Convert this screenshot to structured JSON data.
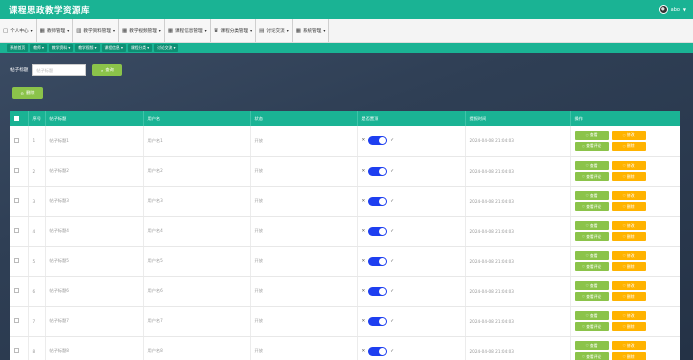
{
  "app": {
    "title": "课程思政教学资源库"
  },
  "user": {
    "name": "abo"
  },
  "nav": {
    "items": [
      {
        "label": "个人中心",
        "icon": "person-icon"
      },
      {
        "label": "教师管理",
        "icon": "grid-icon"
      },
      {
        "label": "教学资料管理",
        "icon": "chart-icon"
      },
      {
        "label": "教学视频管理",
        "icon": "grid-icon"
      },
      {
        "label": "课程信息管理",
        "icon": "grid-icon"
      },
      {
        "label": "课程分类管理",
        "icon": "trophy-icon"
      },
      {
        "label": "讨论交流",
        "icon": "doc-icon"
      },
      {
        "label": "系统管理",
        "icon": "grid-icon"
      }
    ]
  },
  "subnav": {
    "items": [
      "系统首页",
      "教师",
      "教学资料",
      "教学视频",
      "课程信息",
      "课程分类",
      "讨论交流"
    ]
  },
  "search": {
    "label": "帖子标题",
    "placeholder": "帖子标题",
    "button_label": "查询"
  },
  "actions": {
    "delete_label": "删除"
  },
  "table": {
    "headers": [
      "",
      "序号",
      "帖子标题",
      "用户名",
      "状态",
      "是否置顶",
      "提报时间",
      "操作"
    ],
    "op_labels": {
      "view": "查看",
      "edit": "修改",
      "view_comments": "查看评论",
      "delete": "删除"
    },
    "rows": [
      {
        "index": "1",
        "title": "帖子标题1",
        "username": "用户名1",
        "status": "开放",
        "time": "2024-04-08 21:04:03"
      },
      {
        "index": "2",
        "title": "帖子标题2",
        "username": "用户名2",
        "status": "开放",
        "time": "2024-04-08 21:04:03"
      },
      {
        "index": "3",
        "title": "帖子标题3",
        "username": "用户名3",
        "status": "开放",
        "time": "2024-04-08 21:04:03"
      },
      {
        "index": "4",
        "title": "帖子标题4",
        "username": "用户名4",
        "status": "开放",
        "time": "2024-04-08 21:04:03"
      },
      {
        "index": "5",
        "title": "帖子标题5",
        "username": "用户名5",
        "status": "开放",
        "time": "2024-04-08 21:04:03"
      },
      {
        "index": "6",
        "title": "帖子标题6",
        "username": "用户名6",
        "status": "开放",
        "time": "2024-04-08 21:04:03"
      },
      {
        "index": "7",
        "title": "帖子标题7",
        "username": "用户名7",
        "status": "开放",
        "time": "2024-04-08 21:04:03"
      },
      {
        "index": "8",
        "title": "帖子标题8",
        "username": "用户名8",
        "status": "开放",
        "time": "2024-04-08 21:04:03"
      }
    ]
  },
  "colors": {
    "primary": "#1ab394",
    "green_button": "#8bc34a",
    "orange_button": "#ffb300",
    "toggle_on": "#1e3ff0"
  }
}
